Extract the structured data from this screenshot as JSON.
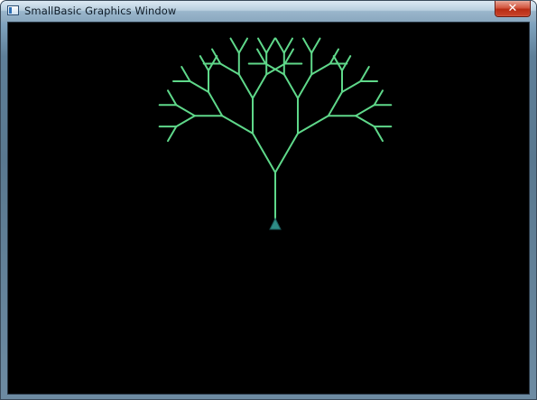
{
  "window": {
    "title": "SmallBasic Graphics Window",
    "close_label": "✕",
    "canvas_background": "#000000"
  },
  "drawing": {
    "line_color": "#5fd88a",
    "turtle_color": "#2e8c86",
    "turtle_outline": "#1a5a5a",
    "tree_depth": 5,
    "branch_angle_deg": 30
  }
}
